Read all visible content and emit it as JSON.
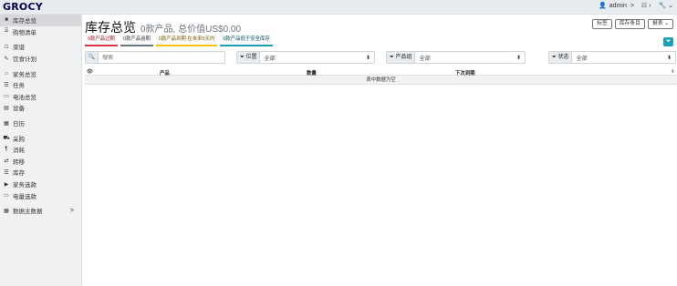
{
  "brand": "GROCY",
  "user": {
    "name": "admin",
    "chev": ">"
  },
  "sidebar": {
    "items": [
      {
        "label": "库存总览",
        "icon": "■",
        "active": true
      },
      {
        "label": "购物清单",
        "icon": "⌸"
      },
      {
        "label": "菜谱",
        "icon": "☖"
      },
      {
        "label": "饮食计划",
        "icon": "✎"
      },
      {
        "label": "家务总览",
        "icon": "⌂"
      },
      {
        "label": "任务",
        "icon": "☰"
      },
      {
        "label": "电池总览",
        "icon": "▭"
      },
      {
        "label": "设备",
        "icon": "▤"
      },
      {
        "label": "日历",
        "icon": "▦"
      },
      {
        "label": "采购",
        "icon": "⛟"
      },
      {
        "label": "消耗",
        "icon": "¶"
      },
      {
        "label": "转移",
        "icon": "⇄"
      },
      {
        "label": "库存",
        "icon": "☰"
      },
      {
        "label": "家务选款",
        "icon": "▶"
      },
      {
        "label": "电量选款",
        "icon": "▭"
      },
      {
        "label": "数据主数据",
        "icon": "▦",
        "chev": ">"
      }
    ]
  },
  "header": {
    "title": "库存总览",
    "subtitle": "0款产品, 总价值US$0.00",
    "buttons": [
      "标签",
      "库存条目",
      "报表 ⌄"
    ]
  },
  "filters": [
    "0款产品过期",
    "0款产品逾期",
    "0款产品到期 在未来5天内",
    "0款产品低于安全库存"
  ],
  "search": {
    "placeholder": "搜索"
  },
  "selects": [
    {
      "label": "位置",
      "value": "全部"
    },
    {
      "label": "产品组",
      "value": "全部"
    },
    {
      "label": "状态",
      "value": "全部"
    }
  ],
  "table": {
    "columns": [
      "产品",
      "数量",
      "下次到期"
    ],
    "empty_text": "表中数据为空"
  }
}
